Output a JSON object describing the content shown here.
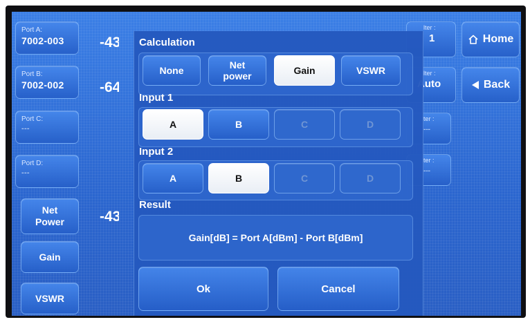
{
  "ports": [
    {
      "label": "Port A:",
      "value": "7002-003"
    },
    {
      "label": "Port B:",
      "value": "7002-002"
    },
    {
      "label": "Port C:",
      "value": "---"
    },
    {
      "label": "Port D:",
      "value": "---"
    }
  ],
  "left_buttons": {
    "net_power": "Net\nPower",
    "gain": "Gain",
    "vswr": "VSWR"
  },
  "readings": {
    "port_a": "-43",
    "port_b": "-64",
    "net_power": "-43"
  },
  "filters": [
    {
      "label": "lter :",
      "value": "1"
    },
    {
      "label": "lter :",
      "value": "Auto"
    },
    {
      "label": "lter :",
      "value": "---"
    },
    {
      "label": "lter :",
      "value": "---"
    }
  ],
  "nav": {
    "home": "Home",
    "back": "Back"
  },
  "dialog": {
    "calculation_label": "Calculation",
    "calculation_options": [
      "None",
      "Net\npower",
      "Gain",
      "VSWR"
    ],
    "calculation_selected": "Gain",
    "input1_label": "Input 1",
    "input1_options": [
      "A",
      "B",
      "C",
      "D"
    ],
    "input1_selected": "A",
    "input2_label": "Input 2",
    "input2_options": [
      "A",
      "B",
      "C",
      "D"
    ],
    "input2_selected": "B",
    "result_label": "Result",
    "result_text": "Gain[dB] = Port A[dBm] - Port B[dBm]",
    "ok_label": "Ok",
    "cancel_label": "Cancel"
  },
  "colors": {
    "screen_blue": "#2e6fd6",
    "selected_button": "#ffffff",
    "disabled_text": "#6f95d4"
  },
  "icons": {
    "home": "house-outline-icon",
    "back": "left-triangle-icon"
  }
}
